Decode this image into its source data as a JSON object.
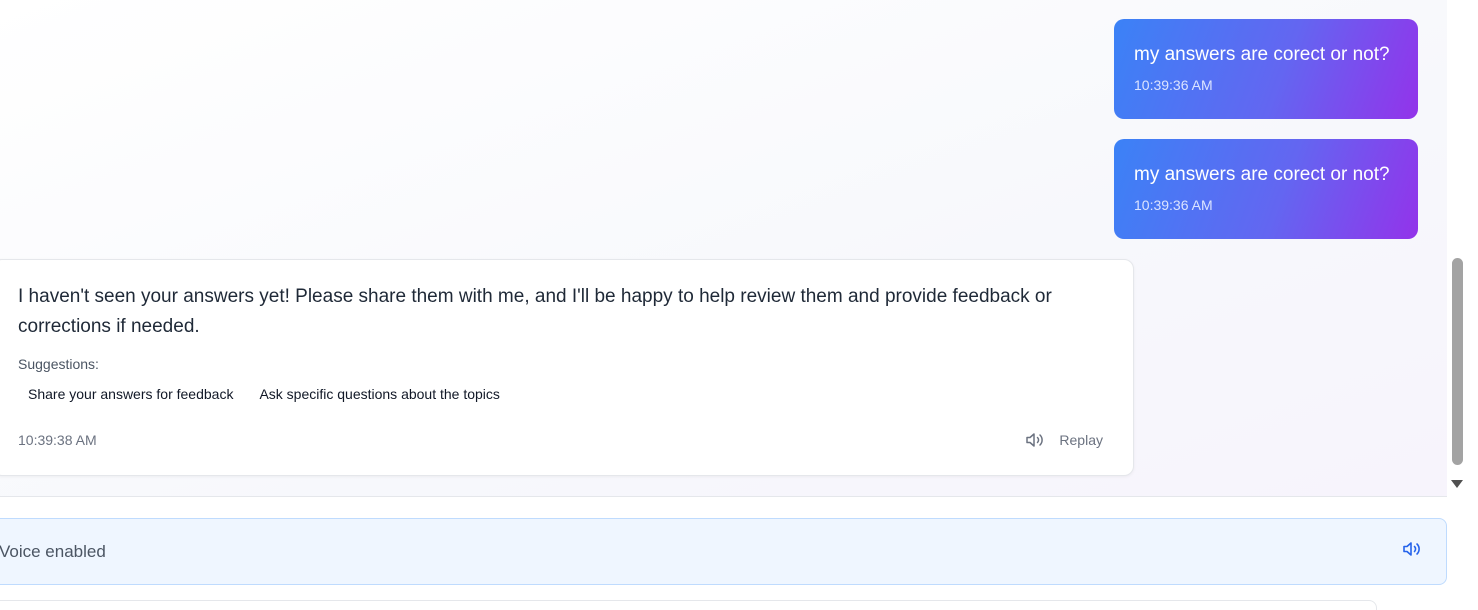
{
  "messages": {
    "user": [
      {
        "text": "my answers are corect or not?",
        "time": "10:39:36 AM"
      },
      {
        "text": "my answers are corect or not?",
        "time": "10:39:36 AM"
      }
    ],
    "assistant": {
      "text": "I haven't seen your answers yet! Please share them with me, and I'll be happy to help review them and provide feedback or corrections if needed.",
      "suggestions_label": "Suggestions:",
      "suggestions": [
        "Share your answers for feedback",
        "Ask specific questions about the topics"
      ],
      "time": "10:39:38 AM",
      "replay_label": "Replay"
    }
  },
  "voice": {
    "status_label": "Voice enabled"
  },
  "icons": {
    "speaker": "speaker-icon",
    "voice_toggle": "speaker-icon"
  },
  "colors": {
    "user_bubble_start": "#3b82f6",
    "user_bubble_end": "#9333ea",
    "voice_bar_bg": "#eff6ff",
    "voice_icon": "#2563eb"
  }
}
